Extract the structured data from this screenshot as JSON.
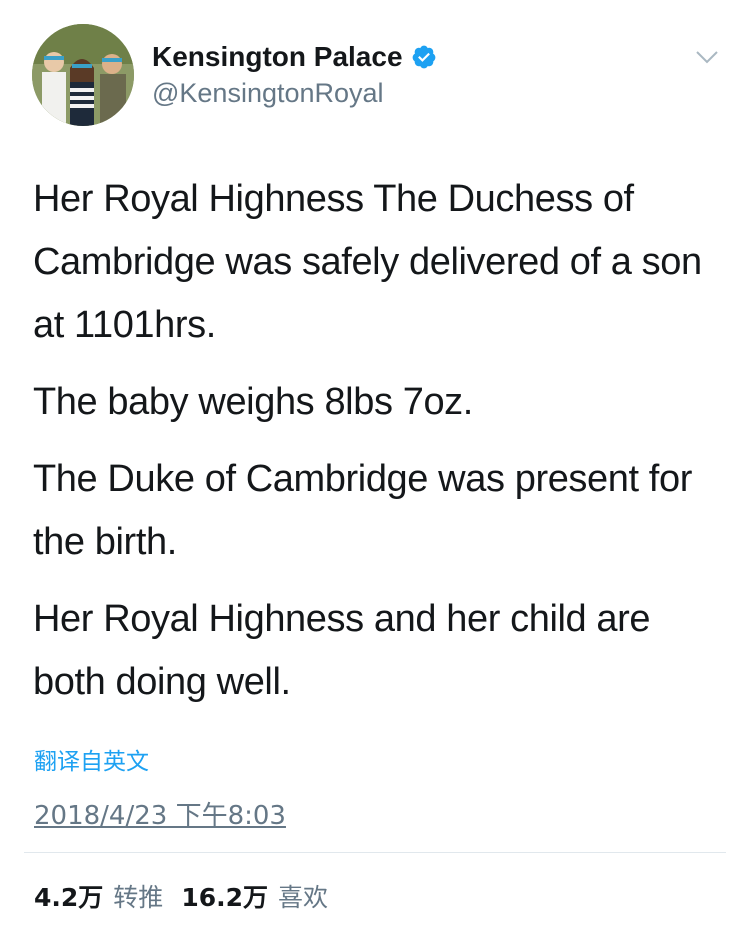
{
  "tweet": {
    "display_name": "Kensington Palace",
    "handle": "@KensingtonRoyal",
    "verified": true,
    "paragraphs": [
      "Her Royal Highness The Duchess of Cambridge was safely delivered of a son at 1101hrs.",
      "The baby weighs 8lbs 7oz.",
      "The Duke of Cambridge was present for the birth.",
      "Her Royal Highness and her child are both doing well."
    ],
    "translate_link": "翻译自英文",
    "timestamp": "2018/4/23 下午8:03",
    "stats": {
      "retweets_count": "4.2万",
      "retweets_label": "转推",
      "likes_count": "16.2万",
      "likes_label": "喜欢"
    }
  },
  "icons": {
    "verified": "verified-badge-icon",
    "menu": "chevron-down-icon"
  },
  "colors": {
    "link_blue": "#1da1f2",
    "secondary_text": "#657786",
    "primary_text": "#14171a",
    "divider": "#e1e8ed"
  }
}
